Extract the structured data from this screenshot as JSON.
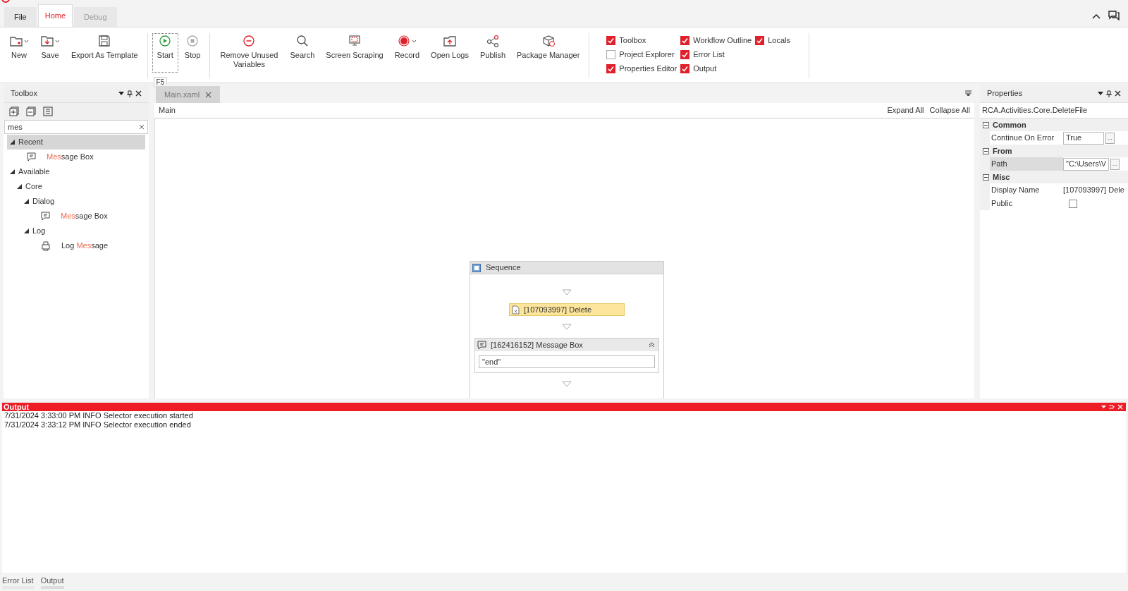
{
  "menu_tabs": [
    {
      "label": "File",
      "selected": false
    },
    {
      "label": "Home",
      "selected": true
    },
    {
      "label": "Debug",
      "selected": false
    }
  ],
  "ribbon_groups": [
    [
      {
        "label": "New",
        "dropdown": true,
        "focused": false
      },
      {
        "label": "Save",
        "dropdown": true,
        "focused": false
      },
      {
        "label": "Export As Template",
        "dropdown": false,
        "focused": false
      }
    ],
    [
      {
        "label": "Start",
        "dropdown": false,
        "focused": true,
        "tooltip": "F5"
      },
      {
        "label": "Stop",
        "dropdown": false,
        "focused": false
      }
    ],
    [
      {
        "label": "Remove Unused Variables",
        "dropdown": false,
        "focused": false
      },
      {
        "label": "Search",
        "dropdown": false,
        "focused": false
      },
      {
        "label": "Screen Scraping",
        "dropdown": false,
        "focused": false
      },
      {
        "label": "Record",
        "dropdown": true,
        "focused": false
      },
      {
        "label": "Open Logs",
        "dropdown": false,
        "focused": false
      },
      {
        "label": "Publish",
        "dropdown": false,
        "focused": false
      },
      {
        "label": "Package Manager",
        "dropdown": false,
        "focused": false
      }
    ]
  ],
  "panel_checkboxes": [
    [
      {
        "label": "Toolbox",
        "checked": true
      },
      {
        "label": "Project Explorer",
        "checked": false
      },
      {
        "label": "Properties Editor",
        "checked": true
      }
    ],
    [
      {
        "label": "Workflow Outline",
        "checked": true
      },
      {
        "label": "Error List",
        "checked": true
      },
      {
        "label": "Output",
        "checked": true
      }
    ],
    [
      {
        "label": "Locals",
        "checked": true
      }
    ]
  ],
  "toolbox": {
    "title": "Toolbox",
    "search": "mes",
    "tree": [
      {
        "text": "Recent",
        "expanded": true,
        "selected": true,
        "children": [
          {
            "kind": "message",
            "highlight": "Mes",
            "rest": "sage Box",
            "selected": false
          }
        ]
      },
      {
        "text": "Available",
        "expanded": true,
        "selected": false,
        "children": [
          {
            "text": "Core",
            "expanded": true,
            "selected": false,
            "children": [
              {
                "text": "Dialog",
                "expanded": true,
                "selected": false,
                "children": [
                  {
                    "kind": "message",
                    "highlight": "Mes",
                    "rest": "sage Box",
                    "selected": false
                  }
                ]
              },
              {
                "text": "Log",
                "expanded": true,
                "selected": false,
                "children": [
                  {
                    "kind": "log",
                    "text": "Log ",
                    "highlight": "Mes",
                    "rest": "sage",
                    "selected": false
                  }
                ]
              }
            ]
          }
        ]
      }
    ]
  },
  "document_tab": "Main.xaml",
  "breadcrumb": "Main",
  "editor_actions": [
    "Expand All",
    "Collapse All"
  ],
  "sequence": {
    "title": "Sequence",
    "activities": [
      {
        "kind": "activity",
        "title": "[107093997] Delete",
        "selected": true
      },
      {
        "kind": "message",
        "title": "[162416152] Message Box",
        "value": "\"end\"",
        "selected": false
      }
    ]
  },
  "properties": {
    "title": "Properties",
    "type_name": "RCA.Activities.Core.DeleteFile",
    "categories": [
      {
        "name": "Common",
        "expanded": true,
        "rows": [
          {
            "name": "Continue On Error",
            "kind": "text",
            "value": "True",
            "button": "...",
            "selected": false
          }
        ]
      },
      {
        "name": "From",
        "expanded": true,
        "rows": [
          {
            "name": "Path",
            "kind": "text",
            "value": "\"C:\\Users\\V",
            "button": "...",
            "selected": true
          }
        ]
      },
      {
        "name": "Misc",
        "expanded": true,
        "rows": [
          {
            "name": "Display Name",
            "kind": "plain",
            "value": "[107093997] Dele",
            "selected": false
          },
          {
            "name": "Public",
            "kind": "checkbox",
            "checked": false,
            "selected": false
          }
        ]
      }
    ]
  },
  "output": {
    "title": "Output",
    "lines": [
      "7/31/2024 3:33:00 PM INFO Selector execution started",
      "7/31/2024 3:33:12 PM INFO Selector execution ended"
    ]
  },
  "bottom_tabs": [
    {
      "label": "Error List",
      "selected": false
    },
    {
      "label": "Output",
      "selected": true
    }
  ]
}
